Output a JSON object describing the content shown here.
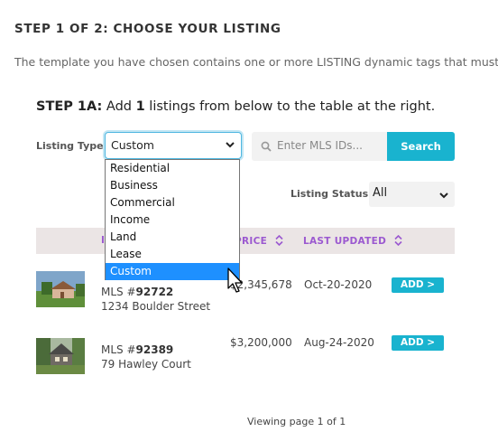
{
  "header": {
    "title": "STEP 1 OF 2: CHOOSE YOUR LISTING",
    "intro": "The template you have chosen contains one or more LISTING dynamic tags that must"
  },
  "step": {
    "label": "STEP 1A:",
    "text_before": "Add",
    "count": "1",
    "text_after": "listings from below to the table at the right."
  },
  "filters": {
    "listing_type_label": "Listing Type",
    "listing_type_value": "Custom",
    "listing_type_options": [
      "Residential",
      "Business",
      "Commercial",
      "Income",
      "Land",
      "Lease",
      "Custom"
    ],
    "search_placeholder": "Enter MLS IDs...",
    "search_button": "Search",
    "listing_status_label": "Listing Status",
    "listing_status_value": "All"
  },
  "table": {
    "columns": {
      "id": "ID",
      "price": "PRICE",
      "updated": "LAST UPDATED"
    },
    "rows": [
      {
        "mls_prefix": "MLS #",
        "mls_id": "92722",
        "address": "1234 Boulder Street",
        "price": "$2,345,678",
        "updated": "Oct-20-2020",
        "action": "ADD >"
      },
      {
        "mls_prefix": "MLS #",
        "mls_id": "92389",
        "address": "79 Hawley Court",
        "price": "$3,200,000",
        "updated": "Aug-24-2020",
        "action": "ADD >"
      }
    ]
  },
  "pager": {
    "prefix": "Viewing page",
    "page": "1",
    "of": "of 1"
  },
  "colors": {
    "accent": "#19b3cf",
    "header_text": "#9b59d0",
    "selected_option": "#1e90ff",
    "focus_border": "#4fb7e0"
  }
}
